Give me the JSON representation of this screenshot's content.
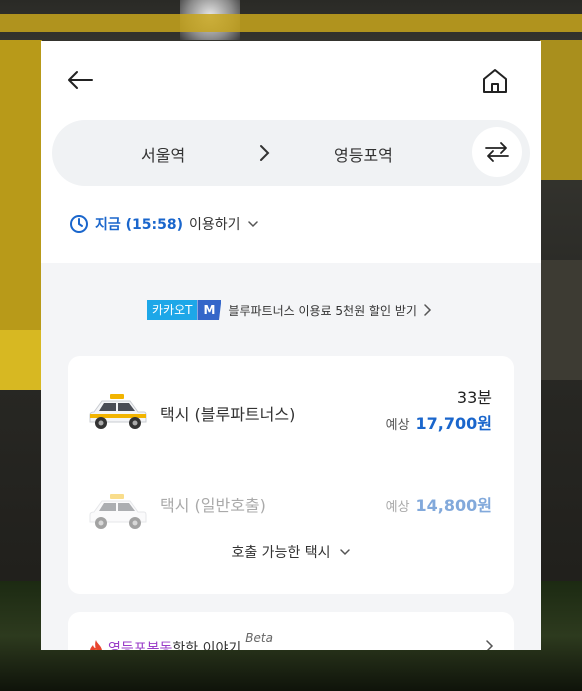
{
  "header": {
    "back_icon": "back-arrow-icon",
    "home_icon": "home-icon"
  },
  "route": {
    "from": "서울역",
    "to": "영등포역",
    "swap_icon": "swap-icon"
  },
  "time": {
    "icon": "clock-icon",
    "now_label": "지금 (15:58)",
    "use_label": "이용하기"
  },
  "promo": {
    "badge_brand": "카카오T",
    "badge_m": "M",
    "text": "블루파트너스 이용료 5천원 할인 받기"
  },
  "options": [
    {
      "name": "택시 (블루파트너스)",
      "eta": "33분",
      "price_label": "예상",
      "price": "17,700원"
    },
    {
      "name": "택시 (일반호출)",
      "price_label": "예상",
      "price": "14,800원"
    }
  ],
  "more_label": "호출 가능한 택시",
  "story": {
    "highlight": "영등포본동",
    "text": " 핫한 이야기",
    "beta": "Beta"
  },
  "colors": {
    "accent": "#1a66cc",
    "promo_brand": "#1da7e8",
    "promo_m": "#3466c9",
    "story_highlight": "#9a3cc8"
  }
}
